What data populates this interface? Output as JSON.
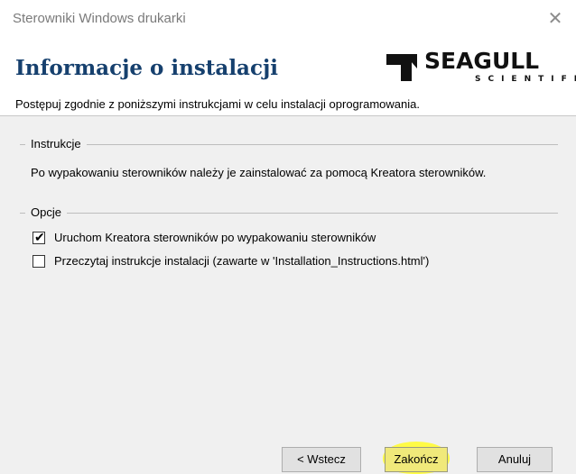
{
  "window": {
    "title": "Sterowniki Windows drukarki",
    "close_glyph": "✕"
  },
  "header": {
    "title": "Informacje o instalacji",
    "subtitle": "Postępuj zgodnie z poniższymi instrukcjami w celu instalacji oprogramowania.",
    "logo": {
      "word": "SEAGULL",
      "sub": "SCIENTIFIC",
      "icon": "seagull-logo-icon"
    }
  },
  "instructions": {
    "group_label": "Instrukcje",
    "text": "Po wypakowaniu sterowników należy je zainstalować za pomocą Kreatora sterowników."
  },
  "options": {
    "group_label": "Opcje",
    "items": [
      {
        "label": "Uruchom Kreatora sterowników po wypakowaniu sterowników",
        "checked": true
      },
      {
        "label": "Przeczytaj instrukcje instalacji (zawarte w 'Installation_Instructions.html')",
        "checked": false
      }
    ]
  },
  "buttons": {
    "back": "< Wstecz",
    "finish": "Zakończ",
    "cancel": "Anuluj"
  },
  "colors": {
    "title": "#16406e",
    "highlight": "#fffb46"
  }
}
